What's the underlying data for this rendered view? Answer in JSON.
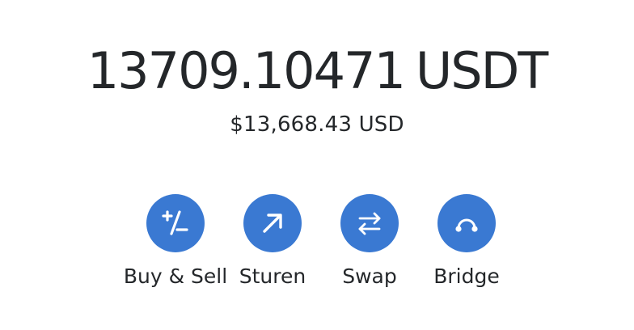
{
  "balance": {
    "amount": "13709.10471",
    "unit": "USDT",
    "fiat": "$13,668.43 USD"
  },
  "actions": [
    {
      "label": "Buy & Sell",
      "icon": "plus-minus-icon"
    },
    {
      "label": "Sturen",
      "icon": "arrow-up-right-icon"
    },
    {
      "label": "Swap",
      "icon": "swap-arrows-icon"
    },
    {
      "label": "Bridge",
      "icon": "bridge-icon"
    }
  ],
  "colors": {
    "accent": "#3a79d2",
    "text": "#24272a",
    "background": "#ffffff"
  }
}
